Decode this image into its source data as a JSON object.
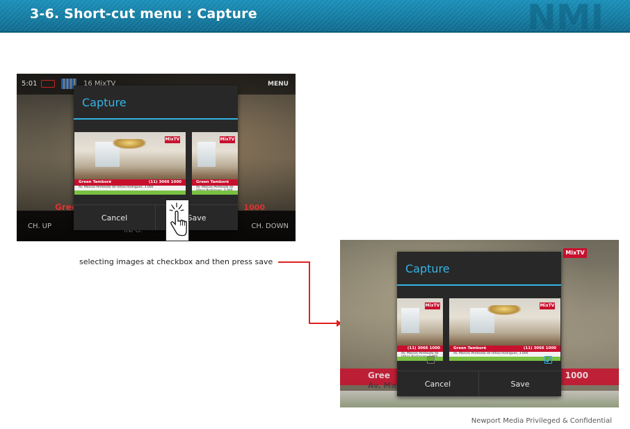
{
  "header": {
    "title": "3-6. Short-cut menu : Capture",
    "logo_text": "NMI"
  },
  "screenshot_before": {
    "status_time": "5:01",
    "channel_name": "16 MixTV",
    "menu_label": "MENU",
    "ch_up_label": "CH. UP",
    "info_label": "INFO.",
    "ch_down_label": "CH. DOWN",
    "bg_text_left": "Gree",
    "bg_text_right": "1000",
    "dialog": {
      "title": "Capture",
      "cancel_label": "Cancel",
      "save_label": "Save"
    }
  },
  "thumbnail": {
    "logo": "MixTV",
    "banner_name": "Green Tamboré",
    "banner_phone": "(11) 3066 1000",
    "banner_address": "Av. Marcos Penteado de Ulhoa Rodrigues, 3.000"
  },
  "annotation": {
    "text": "selecting images at checkbox and then press save"
  },
  "screenshot_after": {
    "bg_text_left": "Gree",
    "bg_text_av": "Av. Mar",
    "bg_text_right": "1000",
    "bg_logo": "MixTV",
    "dialog": {
      "title": "Capture",
      "cancel_label": "Cancel",
      "save_label": "Save"
    },
    "checkbox_1_checked": false,
    "checkbox_2_checked": true
  },
  "footer": {
    "text": "Newport Media Privileged & Confidential"
  },
  "colors": {
    "header_blue": "#1a8fb8",
    "dialog_accent": "#33b5e5",
    "dialog_bg": "#282828",
    "arrow_red": "#e02020",
    "banner_red": "#c8102e"
  }
}
